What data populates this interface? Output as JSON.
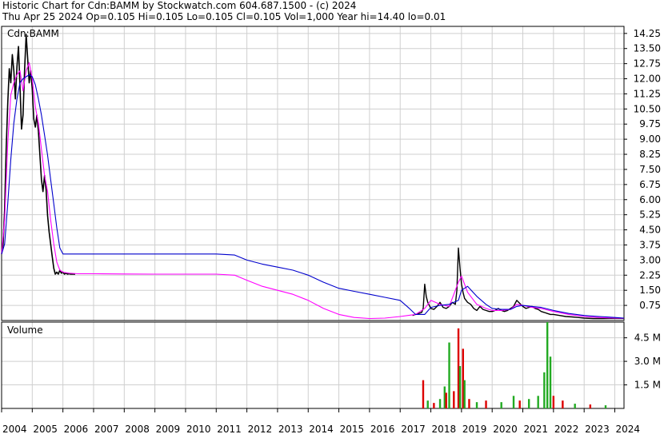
{
  "header": {
    "line1": "Historic Chart for Cdn:BAMM by Stockwatch.com 604.687.1500 - (c) 2024",
    "line2": "Thu Apr 25 2024  Op=0.105  Hi=0.105  Lo=0.105  Cl=0.105  Vol=1,000  Year hi=14.40  lo=0.01"
  },
  "colors": {
    "grid": "#cfcfcf",
    "price": "#000000",
    "ma_short": "#ff00ff",
    "ma_long": "#0000cc",
    "vol_up": "#22aa22",
    "vol_down": "#dd0000"
  },
  "chart_data": [
    {
      "type": "line",
      "title": "Cdn:BAMM",
      "ylim": [
        0,
        14.6
      ],
      "xlim": [
        2004.0,
        2024.3
      ],
      "grid": true,
      "x_tick_labels": [
        "2004",
        "2005",
        "2006",
        "2007",
        "2008",
        "2009",
        "2010",
        "2011",
        "2012",
        "2013",
        "2014",
        "2015",
        "2016",
        "2017",
        "2018",
        "2019",
        "2020",
        "2021",
        "2022",
        "2023",
        "2024"
      ],
      "y_tick_labels": [
        "14.25",
        "13.50",
        "12.75",
        "12.00",
        "11.25",
        "10.50",
        "9.75",
        "9.00",
        "8.25",
        "7.50",
        "6.75",
        "6.00",
        "5.25",
        "4.50",
        "3.75",
        "3.00",
        "2.25",
        "1.50",
        "0.75"
      ],
      "series": [
        {
          "key": "price",
          "x": [
            2004.0,
            2004.05,
            2004.1,
            2004.15,
            2004.2,
            2004.25,
            2004.3,
            2004.35,
            2004.4,
            2004.45,
            2004.5,
            2004.55,
            2004.6,
            2004.65,
            2004.7,
            2004.75,
            2004.8,
            2004.85,
            2004.9,
            2004.95,
            2005.0,
            2005.05,
            2005.1,
            2005.15,
            2005.2,
            2005.25,
            2005.3,
            2005.35,
            2005.4,
            2005.45,
            2005.5,
            2005.55,
            2005.6,
            2005.65,
            2005.7,
            2005.75,
            2005.8,
            2005.85,
            2005.9,
            2005.95,
            2006.0,
            2006.05,
            2006.1,
            2006.15,
            2006.2,
            2006.25,
            2006.3,
            2006.35,
            2006.4
          ],
          "y": [
            3.3,
            3.8,
            5.5,
            8.5,
            10.8,
            12.5,
            11.8,
            13.2,
            12.4,
            11.0,
            12.6,
            13.6,
            11.6,
            9.5,
            10.2,
            12.4,
            14.2,
            13.0,
            11.8,
            12.4,
            11.5,
            10.0,
            9.6,
            10.2,
            9.4,
            8.2,
            7.0,
            6.4,
            7.2,
            6.5,
            5.2,
            4.4,
            3.8,
            3.2,
            2.6,
            2.3,
            2.4,
            2.3,
            2.5,
            2.35,
            2.4,
            2.3,
            2.35,
            2.3,
            2.32,
            2.3,
            2.3,
            2.3,
            2.3
          ]
        },
        {
          "key": "price_late",
          "x": [
            2017.4,
            2017.5,
            2017.6,
            2017.7,
            2017.75,
            2017.8,
            2017.85,
            2017.9,
            2018.0,
            2018.1,
            2018.2,
            2018.3,
            2018.4,
            2018.5,
            2018.6,
            2018.7,
            2018.8,
            2018.85,
            2018.9,
            2018.95,
            2019.0,
            2019.05,
            2019.1,
            2019.2,
            2019.3,
            2019.4,
            2019.5,
            2019.6,
            2019.7,
            2019.8,
            2019.9,
            2020.0,
            2020.1,
            2020.2,
            2020.3,
            2020.4,
            2020.5,
            2020.6,
            2020.7,
            2020.8,
            2020.9,
            2021.0,
            2021.1,
            2021.2,
            2021.3,
            2021.4,
            2021.5,
            2021.6,
            2021.7,
            2021.8,
            2021.9,
            2022.0,
            2022.2,
            2022.4,
            2022.6,
            2022.8,
            2023.0,
            2023.3,
            2023.6,
            2024.0,
            2024.3
          ],
          "y": [
            0.25,
            0.3,
            0.35,
            0.4,
            0.6,
            1.8,
            1.2,
            0.9,
            0.6,
            0.55,
            0.7,
            0.9,
            0.65,
            0.6,
            0.7,
            0.9,
            0.8,
            1.5,
            3.6,
            2.6,
            1.8,
            1.4,
            1.1,
            0.9,
            0.8,
            0.6,
            0.5,
            0.7,
            0.55,
            0.5,
            0.45,
            0.45,
            0.5,
            0.6,
            0.5,
            0.45,
            0.5,
            0.6,
            0.7,
            1.0,
            0.85,
            0.7,
            0.6,
            0.65,
            0.7,
            0.6,
            0.55,
            0.45,
            0.4,
            0.35,
            0.3,
            0.3,
            0.25,
            0.2,
            0.18,
            0.15,
            0.12,
            0.1,
            0.1,
            0.105,
            0.105
          ]
        },
        {
          "key": "ma_short",
          "x": [
            2004.0,
            2004.1,
            2004.2,
            2004.3,
            2004.4,
            2004.5,
            2004.6,
            2004.7,
            2004.8,
            2004.9,
            2005.0,
            2005.1,
            2005.2,
            2005.3,
            2005.4,
            2005.5,
            2005.6,
            2005.7,
            2005.8,
            2005.9,
            2006.0,
            2006.2,
            2006.5,
            2007.0,
            2008.0,
            2009.0,
            2010.0,
            2011.0,
            2011.6,
            2012.0,
            2012.5,
            2013.0,
            2013.5,
            2014.0,
            2014.5,
            2015.0,
            2015.5,
            2016.0,
            2016.5,
            2017.0,
            2017.5,
            2017.8,
            2018.0,
            2018.3,
            2018.6,
            2018.9,
            2019.0,
            2019.2,
            2019.5,
            2019.8,
            2020.0,
            2020.3,
            2020.6,
            2020.8,
            2021.0,
            2021.3,
            2021.6,
            2022.0,
            2022.5,
            2023.0,
            2023.5,
            2024.0,
            2024.3
          ],
          "y": [
            3.3,
            5.0,
            8.8,
            11.2,
            11.8,
            12.2,
            12.4,
            11.4,
            12.4,
            12.8,
            12.0,
            10.6,
            9.8,
            8.5,
            7.2,
            6.4,
            5.0,
            3.8,
            2.9,
            2.5,
            2.4,
            2.35,
            2.32,
            2.32,
            2.31,
            2.3,
            2.3,
            2.3,
            2.25,
            2.0,
            1.7,
            1.5,
            1.3,
            1.0,
            0.6,
            0.3,
            0.15,
            0.1,
            0.12,
            0.2,
            0.3,
            0.6,
            1.0,
            0.8,
            0.7,
            1.9,
            2.2,
            1.4,
            0.8,
            0.6,
            0.5,
            0.5,
            0.55,
            0.8,
            0.75,
            0.65,
            0.6,
            0.45,
            0.3,
            0.2,
            0.15,
            0.12,
            0.11
          ]
        },
        {
          "key": "ma_long",
          "x": [
            2004.0,
            2004.1,
            2004.2,
            2004.3,
            2004.4,
            2004.5,
            2004.6,
            2004.7,
            2004.8,
            2004.9,
            2005.0,
            2005.1,
            2005.2,
            2005.3,
            2005.4,
            2005.5,
            2005.6,
            2005.7,
            2005.8,
            2005.9,
            2006.0,
            2006.2,
            2006.5,
            2007.0,
            2008.0,
            2009.0,
            2010.0,
            2011.0,
            2011.6,
            2012.0,
            2012.5,
            2013.0,
            2013.5,
            2014.0,
            2014.5,
            2015.0,
            2015.5,
            2016.0,
            2016.5,
            2017.0,
            2017.3,
            2017.5,
            2017.8,
            2018.0,
            2018.3,
            2018.6,
            2018.9,
            2019.0,
            2019.2,
            2019.5,
            2019.8,
            2020.0,
            2020.3,
            2020.6,
            2020.8,
            2021.0,
            2021.3,
            2021.6,
            2022.0,
            2022.5,
            2023.0,
            2023.5,
            2024.0,
            2024.3
          ],
          "y": [
            3.3,
            3.8,
            5.8,
            8.0,
            9.8,
            11.0,
            11.8,
            12.0,
            12.1,
            12.2,
            12.1,
            11.7,
            11.0,
            10.2,
            9.2,
            8.2,
            7.0,
            5.8,
            4.6,
            3.6,
            3.3,
            3.3,
            3.3,
            3.3,
            3.3,
            3.3,
            3.3,
            3.3,
            3.25,
            3.0,
            2.8,
            2.65,
            2.5,
            2.25,
            1.9,
            1.6,
            1.45,
            1.3,
            1.15,
            1.0,
            0.6,
            0.3,
            0.3,
            0.65,
            0.75,
            0.8,
            1.0,
            1.5,
            1.7,
            1.2,
            0.8,
            0.6,
            0.55,
            0.55,
            0.7,
            0.75,
            0.7,
            0.65,
            0.5,
            0.35,
            0.25,
            0.2,
            0.15,
            0.12
          ]
        }
      ]
    },
    {
      "type": "bar",
      "title": "Volume",
      "ylim": [
        0,
        5.5
      ],
      "y_tick_labels": [
        "4.5 M",
        "3.0 M",
        "1.5 M"
      ],
      "bars": [
        {
          "x": 2017.75,
          "value": 1.8,
          "dir": "down"
        },
        {
          "x": 2017.9,
          "value": 0.5,
          "dir": "up"
        },
        {
          "x": 2018.1,
          "value": 0.35,
          "dir": "down"
        },
        {
          "x": 2018.3,
          "value": 0.6,
          "dir": "up"
        },
        {
          "x": 2018.45,
          "value": 1.4,
          "dir": "up"
        },
        {
          "x": 2018.5,
          "value": 1.0,
          "dir": "down"
        },
        {
          "x": 2018.6,
          "value": 4.2,
          "dir": "up"
        },
        {
          "x": 2018.75,
          "value": 1.1,
          "dir": "down"
        },
        {
          "x": 2018.9,
          "value": 5.1,
          "dir": "down"
        },
        {
          "x": 2018.95,
          "value": 2.7,
          "dir": "up"
        },
        {
          "x": 2019.05,
          "value": 3.8,
          "dir": "down"
        },
        {
          "x": 2019.1,
          "value": 1.8,
          "dir": "up"
        },
        {
          "x": 2019.25,
          "value": 0.6,
          "dir": "down"
        },
        {
          "x": 2019.5,
          "value": 0.4,
          "dir": "up"
        },
        {
          "x": 2019.8,
          "value": 0.5,
          "dir": "down"
        },
        {
          "x": 2020.3,
          "value": 0.4,
          "dir": "up"
        },
        {
          "x": 2020.7,
          "value": 0.8,
          "dir": "up"
        },
        {
          "x": 2020.9,
          "value": 0.5,
          "dir": "down"
        },
        {
          "x": 2021.2,
          "value": 0.6,
          "dir": "up"
        },
        {
          "x": 2021.5,
          "value": 0.8,
          "dir": "up"
        },
        {
          "x": 2021.7,
          "value": 2.3,
          "dir": "up"
        },
        {
          "x": 2021.8,
          "value": 5.5,
          "dir": "up"
        },
        {
          "x": 2021.9,
          "value": 3.3,
          "dir": "up"
        },
        {
          "x": 2022.0,
          "value": 0.8,
          "dir": "down"
        },
        {
          "x": 2022.3,
          "value": 0.5,
          "dir": "down"
        },
        {
          "x": 2022.7,
          "value": 0.3,
          "dir": "up"
        },
        {
          "x": 2023.2,
          "value": 0.25,
          "dir": "down"
        },
        {
          "x": 2023.7,
          "value": 0.2,
          "dir": "up"
        }
      ]
    }
  ]
}
